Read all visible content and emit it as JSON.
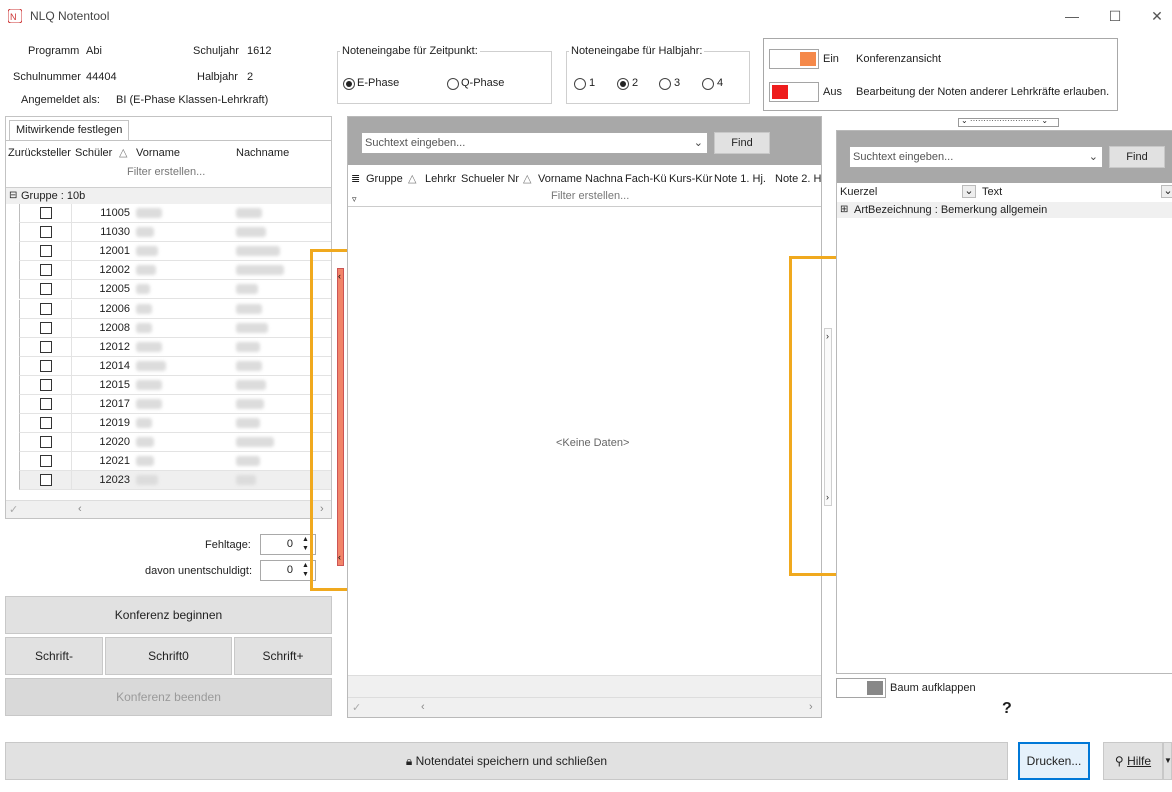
{
  "window": {
    "title": "NLQ Notentool"
  },
  "info": {
    "programm_label": "Programm",
    "programm_value": "Abi",
    "schuljahr_label": "Schuljahr",
    "schuljahr_value": "1612",
    "schulnummer_label": "Schulnummer",
    "schulnummer_value": "44404",
    "halbjahr_label": "Halbjahr",
    "halbjahr_value": "2",
    "angemeldet_label": "Angemeldet als:",
    "angemeldet_value": "BI (E-Phase Klassen-Lehrkraft)"
  },
  "zeitpunkt": {
    "title": "Noteneingabe für Zeitpunkt:",
    "options": [
      "E-Phase",
      "Q-Phase"
    ],
    "selected": "E-Phase"
  },
  "halbjahr_group": {
    "title": "Noteneingabe für Halbjahr:",
    "options": [
      "1",
      "2",
      "3",
      "4"
    ],
    "selected": "2"
  },
  "toggles": {
    "konferenz": {
      "state": "Ein",
      "label": "Konferenzansicht",
      "color": "#f5894a"
    },
    "bearbeitung": {
      "state": "Aus",
      "label": "Bearbeitung der Noten anderer Lehrkräfte erlauben.",
      "color": "#ee1c1c"
    }
  },
  "left": {
    "tab": "Mitwirkende festlegen",
    "columns": [
      "Zurücksteller",
      "Schüler",
      "Vorname",
      "Nachname"
    ],
    "filter": "Filter erstellen...",
    "group_label": "Gruppe : 10b",
    "students": [
      "11005",
      "11030",
      "12001",
      "12002",
      "12005",
      "12006",
      "12008",
      "12012",
      "12014",
      "12015",
      "12017",
      "12019",
      "12020",
      "12021",
      "12023"
    ],
    "fehltage_label": "Fehltage:",
    "fehltage_value": "0",
    "unentschuldigt_label": "davon unentschuldigt:",
    "unentschuldigt_value": "0",
    "btn_begin": "Konferenz beginnen",
    "btn_schrift_minus": "Schrift-",
    "btn_schrift_zero": "Schrift0",
    "btn_schrift_plus": "Schrift+",
    "btn_end": "Konferenz beenden"
  },
  "middle": {
    "search_placeholder": "Suchtext eingeben...",
    "find": "Find",
    "columns": [
      "Gruppe",
      "Lehrkr",
      "Schueler Nr",
      "Vorname",
      "Nachna",
      "Fach-Kü",
      "Kurs-Kür",
      "Note 1. Hj.",
      "Note 2. H"
    ],
    "filter": "Filter erstellen...",
    "empty": "<Keine Daten>"
  },
  "right": {
    "search_placeholder": "Suchtext eingeben...",
    "find": "Find",
    "col_kuerzel": "Kuerzel",
    "col_text": "Text",
    "group_row": "ArtBezeichnung : Bemerkung allgemein",
    "tree_label": "Baum aufklappen",
    "help_glyph": "?"
  },
  "bottom": {
    "save": "Notendatei speichern und schließen",
    "print": "Drucken...",
    "help": "Hilfe"
  }
}
